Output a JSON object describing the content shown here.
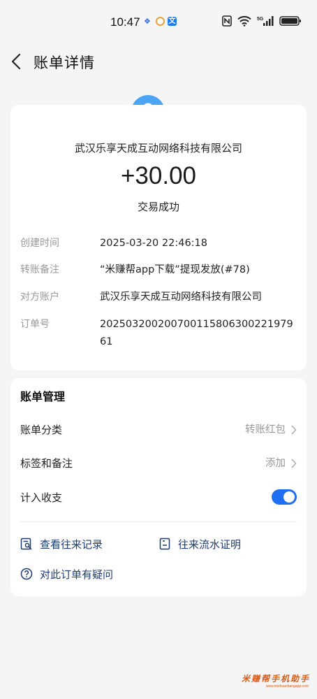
{
  "status_bar": {
    "time": "10:47",
    "icons": [
      "paw-icon",
      "ring-icon",
      "wen-icon",
      "nfc-icon",
      "wifi-icon",
      "signal-5g-icon",
      "battery-icon"
    ],
    "wen_glyph": "文"
  },
  "header": {
    "title": "账单详情"
  },
  "transaction": {
    "payee": "武汉乐享天成互动网络科技有限公司",
    "amount": "+30.00",
    "status": "交易成功",
    "details": [
      {
        "label": "创建时间",
        "value": "2025-03-20 22:46:18"
      },
      {
        "label": "转账备注",
        "value": "“米赚帮app下载”提现发放(#78)"
      },
      {
        "label": "对方账户",
        "value": "武汉乐享天成互动网络科技有限公司"
      },
      {
        "label": "订单号",
        "value": "20250320020070011580630022197961"
      }
    ]
  },
  "manage": {
    "title": "账单管理",
    "category": {
      "label": "账单分类",
      "value": "转账红包"
    },
    "tags": {
      "label": "标签和备注",
      "value": "添加"
    },
    "include": {
      "label": "计入收支",
      "enabled": true
    },
    "links": {
      "records": "查看往来记录",
      "proof": "往来流水证明",
      "question": "对此订单有疑问"
    }
  },
  "watermark": {
    "text": "米赚帮手机助手",
    "sub": "www.mizhuanbangapp.com"
  },
  "colors": {
    "accent": "#1e6ff1",
    "avatar": "#4aa5f5",
    "link": "#1f3b6e",
    "watermark": "#d85c1a"
  }
}
